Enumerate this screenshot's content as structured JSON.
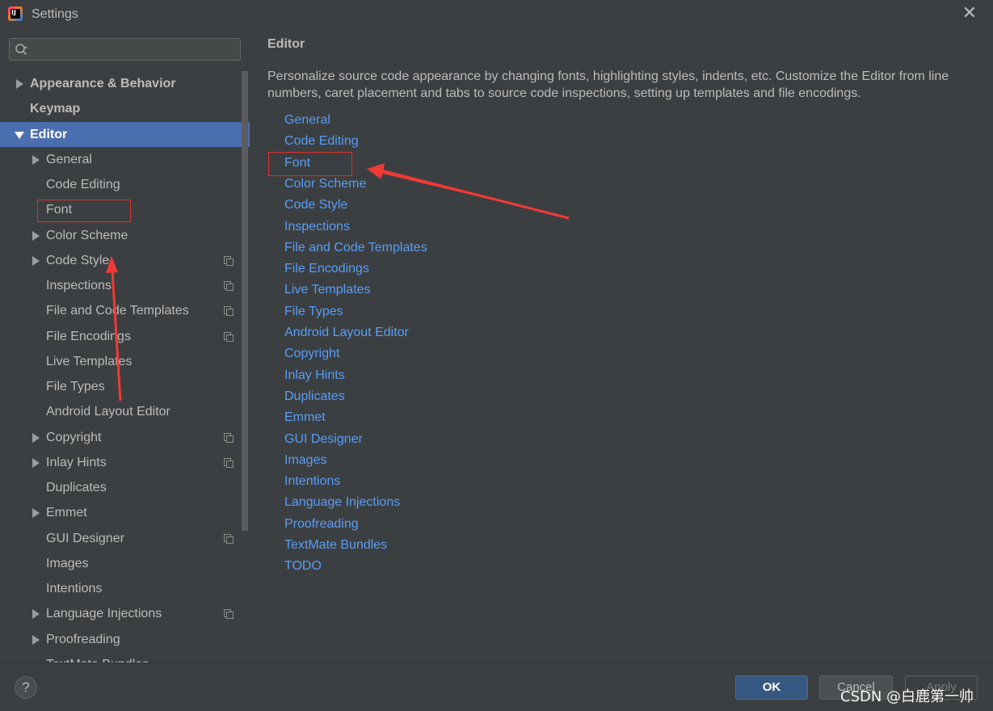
{
  "window": {
    "title": "Settings",
    "app_icon_text": "IJ",
    "close_glyph": "✕"
  },
  "search": {
    "placeholder": "",
    "value": ""
  },
  "sidebar": {
    "items": [
      {
        "label": "Appearance & Behavior",
        "bold": true,
        "arrow": "right"
      },
      {
        "label": "Keymap",
        "bold": true,
        "arrow": ""
      },
      {
        "label": "Editor",
        "bold": true,
        "arrow": "down",
        "selected": true
      },
      {
        "label": "General",
        "arrow": "right"
      },
      {
        "label": "Code Editing",
        "arrow": ""
      },
      {
        "label": "Font",
        "arrow": "",
        "highlighted": true
      },
      {
        "label": "Color Scheme",
        "arrow": "right"
      },
      {
        "label": "Code Style",
        "arrow": "right",
        "copy_icon": true
      },
      {
        "label": "Inspections",
        "arrow": "",
        "copy_icon": true
      },
      {
        "label": "File and Code Templates",
        "arrow": "",
        "copy_icon": true
      },
      {
        "label": "File Encodings",
        "arrow": "",
        "copy_icon": true
      },
      {
        "label": "Live Templates",
        "arrow": ""
      },
      {
        "label": "File Types",
        "arrow": ""
      },
      {
        "label": "Android Layout Editor",
        "arrow": ""
      },
      {
        "label": "Copyright",
        "arrow": "right",
        "copy_icon": true
      },
      {
        "label": "Inlay Hints",
        "arrow": "right",
        "copy_icon": true
      },
      {
        "label": "Duplicates",
        "arrow": ""
      },
      {
        "label": "Emmet",
        "arrow": "right"
      },
      {
        "label": "GUI Designer",
        "arrow": "",
        "copy_icon": true
      },
      {
        "label": "Images",
        "arrow": ""
      },
      {
        "label": "Intentions",
        "arrow": ""
      },
      {
        "label": "Language Injections",
        "arrow": "right",
        "copy_icon": true
      },
      {
        "label": "Proofreading",
        "arrow": "right"
      },
      {
        "label": "TextMate Bundles",
        "arrow": ""
      }
    ]
  },
  "main": {
    "title": "Editor",
    "description": "Personalize source code appearance by changing fonts, highlighting styles, indents, etc. Customize the Editor from line numbers, caret placement and tabs to source code inspections, setting up templates and file encodings.",
    "links": [
      "General",
      "Code Editing",
      "Font",
      "Color Scheme",
      "Code Style",
      "Inspections",
      "File and Code Templates",
      "File Encodings",
      "Live Templates",
      "File Types",
      "Android Layout Editor",
      "Copyright",
      "Inlay Hints",
      "Duplicates",
      "Emmet",
      "GUI Designer",
      "Images",
      "Intentions",
      "Language Injections",
      "Proofreading",
      "TextMate Bundles",
      "TODO"
    ]
  },
  "footer": {
    "help_label": "?",
    "ok_label": "OK",
    "cancel_label": "Cancel",
    "apply_label": "Apply",
    "watermark": "CSDN @白鹿第一帅"
  },
  "colors": {
    "background": "#3c3f41",
    "selection": "#4b6eaf",
    "link": "#589df6",
    "annotation_red": "#e0302f"
  }
}
